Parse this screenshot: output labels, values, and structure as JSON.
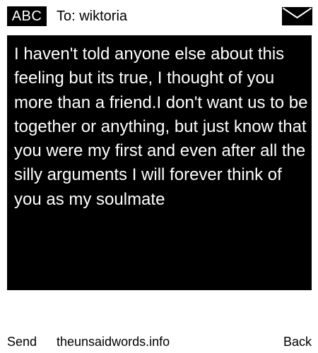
{
  "header": {
    "mode_label": "ABC",
    "recipient": "To: wiktoria",
    "envelope_icon": "envelope-icon"
  },
  "message": {
    "body": "I haven't told anyone else about this feeling but its true, I thought of you more than a friend.I don't want us to be together or anything, but just know that you were my first and even after all the silly arguments I will forever think of you as my soulmate"
  },
  "footer": {
    "send_label": "Send",
    "site_label": "theunsaidwords.info",
    "back_label": "Back"
  },
  "colors": {
    "background": "#ffffff",
    "message_bg": "#000000",
    "message_text": "#ffffff",
    "text": "#000000"
  }
}
